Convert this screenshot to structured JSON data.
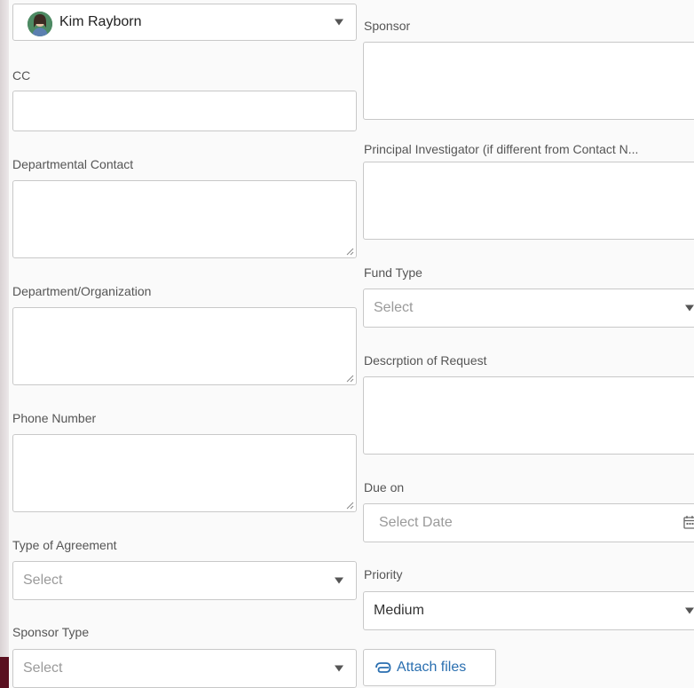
{
  "assignee": {
    "name": "Kim Rayborn"
  },
  "left": {
    "cc_label": "CC",
    "departmental_contact_label": "Departmental Contact",
    "department_label": "Department/Organization",
    "phone_label": "Phone Number",
    "agreement_type_label": "Type of Agreement",
    "agreement_type_value": "Select",
    "sponsor_type_label": "Sponsor Type",
    "sponsor_type_value": "Select"
  },
  "right": {
    "sponsor_label": "Sponsor",
    "pi_label": "Principal Investigator (if different from Contact N...",
    "fund_type_label": "Fund Type",
    "fund_type_value": "Select",
    "description_label": "Descrption of Request",
    "due_label": "Due on",
    "due_placeholder": "Select Date",
    "priority_label": "Priority",
    "priority_value": "Medium",
    "attach_label": "Attach files"
  },
  "colors": {
    "link": "#2a6fb0",
    "border": "#c8c8c8",
    "label": "#555555"
  }
}
